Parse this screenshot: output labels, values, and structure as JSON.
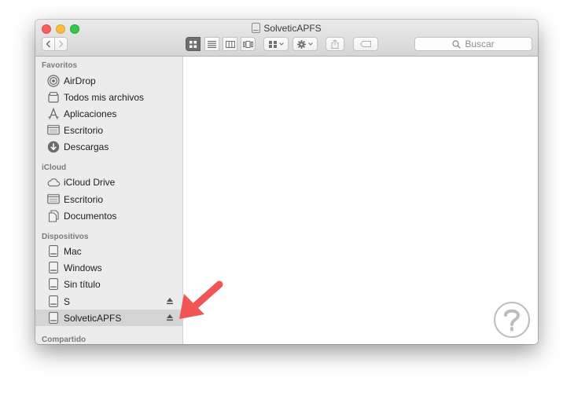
{
  "window": {
    "title": "SolveticAPFS",
    "search_placeholder": "Buscar",
    "toolbar_icons": [
      "back-icon",
      "forward-icon",
      "icon-view-icon",
      "list-view-icon",
      "column-view-icon",
      "cover-flow-icon",
      "group-icon",
      "action-gear-icon",
      "share-icon",
      "tag-icon"
    ]
  },
  "sidebar": {
    "favoritos": {
      "heading": "Favoritos",
      "items": [
        {
          "label": "AirDrop",
          "icon": "airdrop-icon"
        },
        {
          "label": "Todos mis archivos",
          "icon": "all-files-icon"
        },
        {
          "label": "Aplicaciones",
          "icon": "applications-icon"
        },
        {
          "label": "Escritorio",
          "icon": "desktop-icon"
        },
        {
          "label": "Descargas",
          "icon": "downloads-icon"
        }
      ]
    },
    "icloud": {
      "heading": "iCloud",
      "items": [
        {
          "label": "iCloud Drive",
          "icon": "cloud-icon"
        },
        {
          "label": "Escritorio",
          "icon": "desktop-icon"
        },
        {
          "label": "Documentos",
          "icon": "documents-icon"
        }
      ]
    },
    "dispositivos": {
      "heading": "Dispositivos",
      "items": [
        {
          "label": "Mac",
          "icon": "disk-icon"
        },
        {
          "label": "Windows",
          "icon": "disk-icon"
        },
        {
          "label": "Sin título",
          "icon": "disk-icon"
        },
        {
          "label": "S",
          "icon": "disk-icon",
          "ejectable": true
        },
        {
          "label": "SolveticAPFS",
          "icon": "disk-icon",
          "ejectable": true,
          "selected": true
        }
      ]
    },
    "compartido": {
      "heading": "Compartido"
    }
  },
  "colors": {
    "annotation_arrow": "#f25555",
    "selection": "#d4d4d4",
    "sidebar_bg": "#ececec"
  }
}
